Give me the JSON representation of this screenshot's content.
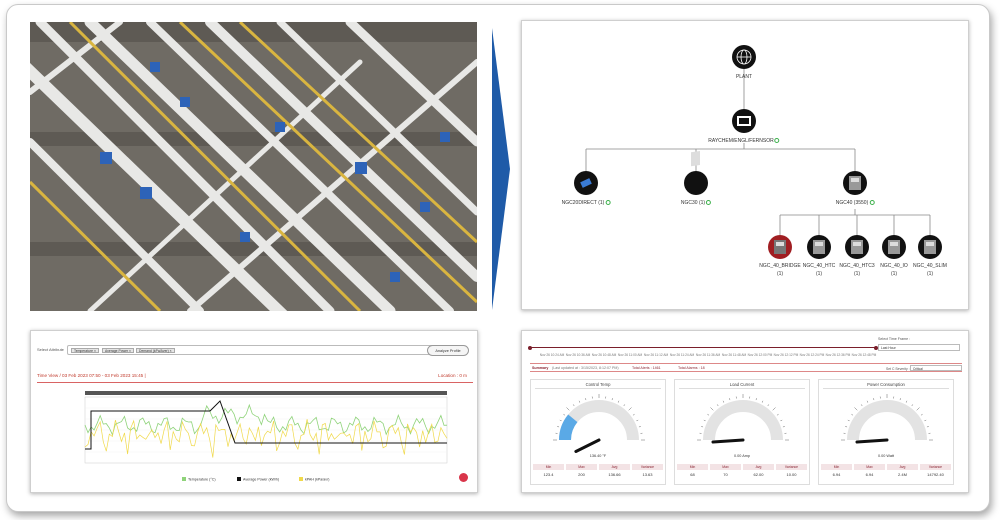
{
  "tree": {
    "root": "PLANT",
    "second": "RAYCHEM/ENGL/FERNSOR",
    "level2": [
      "NGC20DIRECT (1)",
      "NGC30 (1)",
      "NGC40 (3550)"
    ],
    "leaves": [
      "NGC_40_BRIDGE",
      "NGC_40_HTC",
      "NGC_40_HTC3",
      "NGC_40_IO",
      "NGC_40_SLIM"
    ],
    "leaf_counts": [
      "(1)",
      "(1)",
      "(1)",
      "(1)",
      "(1)"
    ]
  },
  "trend": {
    "select_label": "Select Attribute",
    "chips": [
      "Temperature ×",
      "Average Power ×",
      "Demand (kPa/Aver) ×"
    ],
    "analyze_button": "Analyze Profile",
    "time_view": "Time View / 03 Feb 2023 07:50 - 03 Feb 2023 15:45 |",
    "location": "Location : 0 m",
    "legend": [
      "Temperature (°C)",
      "Average Power (kW/h)",
      "kPAH (kPa/avr)"
    ],
    "colors": {
      "temp": "#8fd37a",
      "power": "#111111",
      "kpah": "#f0d94a"
    }
  },
  "gauges": {
    "time_frame_label": "Select Time Frame :",
    "time_frame_value": "Last Hour",
    "timeline_ticks": [
      "Nov 26 10:24 AM",
      "Nov 26 10:36 AM",
      "Nov 26 10:48 AM",
      "Nov 26 11:00 AM",
      "Nov 26 11:12 AM",
      "Nov 26 11:24 AM",
      "Nov 26 11:36 AM",
      "Nov 26 11:48 AM",
      "Nov 26 12:00 PM",
      "Nov 26 12:12 PM",
      "Nov 26 12:24 PM",
      "Nov 26 12:36 PM",
      "Nov 26 12:48 PM"
    ],
    "summary": "Summary",
    "last_updated": "(Last updated at : 3/15/2023, 8:12:07 PM)",
    "total_alerts": "Total Alerts : 1461",
    "total_alarms": "Total Alarms : 18",
    "severity_label": "Set C Severity :",
    "severity_value": "Critical",
    "cards": [
      {
        "title": "Control Temp",
        "value": "136.40 °F",
        "stats": [
          [
            "Min",
            "123.4"
          ],
          [
            "Max",
            "200"
          ],
          [
            "Avg",
            "136.66"
          ],
          [
            "Variance",
            "13.63"
          ]
        ],
        "fraction": 0.22
      },
      {
        "title": "Load Current",
        "value": "0.00 Amp",
        "stats": [
          [
            "Min",
            "68"
          ],
          [
            "Max",
            "70"
          ],
          [
            "Avg",
            "62.00"
          ],
          [
            "Variance",
            "10.00"
          ]
        ],
        "fraction": 0.0
      },
      {
        "title": "Power Consumption",
        "value": "0.00 Watt",
        "stats": [
          [
            "Min",
            "6.94"
          ],
          [
            "Max",
            "6.94"
          ],
          [
            "Avg",
            "2.4M"
          ],
          [
            "Variance",
            "14792.40"
          ]
        ],
        "fraction": 0.0
      }
    ]
  }
}
